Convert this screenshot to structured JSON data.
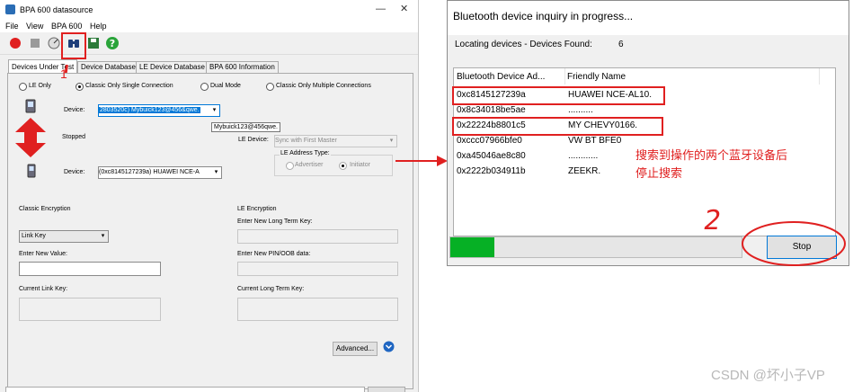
{
  "main": {
    "title": "BPA 600 datasource",
    "menu": [
      "File",
      "View",
      "BPA 600",
      "Help"
    ],
    "tabs": [
      "Devices Under Test",
      "Device Database",
      "LE Device Database",
      "BPA 600 Information"
    ],
    "modes": [
      "LE Only",
      "Classic Only Single Connection",
      "Dual Mode",
      "Classic Only Multiple Connections"
    ],
    "device_label": "Device:",
    "device1_value": "2803520c) Mybuick123@456&qwe.",
    "device1_tooltip": "Mybuick123@456qwe.",
    "status": "Stopped",
    "le_device_label": "LE Device:",
    "le_device_value": "Sync with First Master",
    "le_address_type_label": "LE Address Type:",
    "le_advertiser": "Advertiser",
    "le_initiator": "Initiator",
    "device2_value": "(0xc8145127239a) HUAWEI NCE-A",
    "classic_encryption_label": "Classic Encryption",
    "link_key_value": "Link Key",
    "enter_new_value_label": "Enter New Value:",
    "current_link_key_label": "Current Link Key:",
    "le_encryption_label": "LE Encryption",
    "enter_ltk_label": "Enter New Long Term Key:",
    "enter_pin_label": "Enter New PIN/OOB data:",
    "current_ltk_label": "Current Long Term Key:",
    "advanced_button": "Advanced...",
    "annot_1": "1"
  },
  "dialog": {
    "title": "Bluetooth device inquiry in progress...",
    "locating_label": "Locating devices - Devices Found:",
    "found_count": "6",
    "columns": [
      "Bluetooth Device Ad...",
      "Friendly Name"
    ],
    "rows": [
      {
        "addr": "0xc8145127239a",
        "name": "HUAWEI NCE-AL10."
      },
      {
        "addr": "0x8c34018be5ae",
        "name": ".........."
      },
      {
        "addr": "0x22224b8801c5",
        "name": "MY CHEVY0166."
      },
      {
        "addr": "0xccc07966bfe0",
        "name": "VW BT BFE0"
      },
      {
        "addr": "0xa45046ae8c80",
        "name": "............"
      },
      {
        "addr": "0x2222b034911b",
        "name": "ZEEKR."
      }
    ],
    "progress": 0.15,
    "stop_button": "Stop"
  },
  "annotations": {
    "note_line1": "搜索到操作的两个蓝牙设备后",
    "note_line2": "停止搜索",
    "num_2": "2"
  },
  "watermark": "CSDN @坏小子VP",
  "colors": {
    "accent_red": "#e02020",
    "progress_green": "#06b025",
    "stop_border": "#0078d7"
  }
}
